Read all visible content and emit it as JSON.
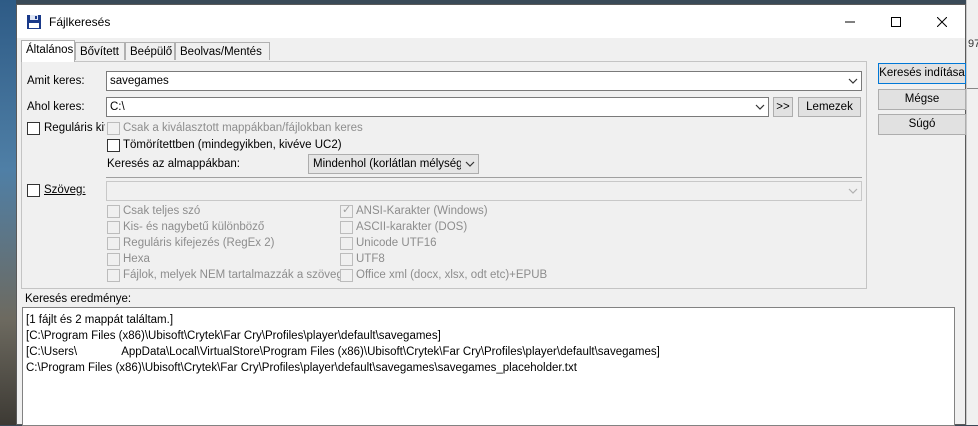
{
  "window": {
    "title": "Fájlkeresés"
  },
  "tabs": [
    "Általános",
    "Bővített",
    "Beépülő",
    "Beolvas/Mentés"
  ],
  "search_what": {
    "label": "Amit keres:",
    "value": "savegames"
  },
  "search_where": {
    "label": "Ahol keres:",
    "value": "C:\\",
    "arrows_label": ">>",
    "drives_label": "Lemezek"
  },
  "buttons": {
    "start": "Keresés indítása",
    "cancel": "Mégse",
    "help": "Súgó"
  },
  "options": {
    "regex_label": "Reguláris kife",
    "regex_checked": false,
    "selected_dirs_label": "Csak a kiválasztott mappákban/fájlokban keres",
    "compressed_label": "Tömörítettben (mindegyikben, kivéve UC2)",
    "subdirs_label": "Keresés az almappákban:",
    "subdirs_value": "Mindenhol (korlátlan mélységbe"
  },
  "text_search": {
    "label": "Szöveg:",
    "checked": false,
    "left_options": [
      {
        "label": "Csak teljes szó",
        "checked": false
      },
      {
        "label": "Kis- és nagybetű különböző",
        "checked": false
      },
      {
        "label": "Reguláris kifejezés (RegEx 2)",
        "checked": false
      },
      {
        "label": "Hexa",
        "checked": false
      },
      {
        "label": "Fájlok, melyek NEM tartalmazzák a szöveget",
        "checked": false
      }
    ],
    "right_options": [
      {
        "label": "ANSI-Karakter (Windows)",
        "checked": true
      },
      {
        "label": "ASCII-karakter (DOS)",
        "checked": false
      },
      {
        "label": "Unicode UTF16",
        "checked": false
      },
      {
        "label": "UTF8",
        "checked": false
      },
      {
        "label": "Office xml (docx, xlsx, odt etc)+EPUB",
        "checked": false
      }
    ]
  },
  "results": {
    "label": "Keresés eredménye:",
    "lines": [
      "[1 fájlt és 2 mappát találtam.]",
      "[C:\\Program Files (x86)\\Ubisoft\\Crytek\\Far Cry\\Profiles\\player\\default\\savegames]",
      "[C:\\Users\\              AppData\\Local\\VirtualStore\\Program Files (x86)\\Ubisoft\\Crytek\\Far Cry\\Profiles\\player\\default\\savegames]",
      "C:\\Program Files (x86)\\Ubisoft\\Crytek\\Far Cry\\Profiles\\player\\default\\savegames\\savegames_placeholder.txt"
    ]
  },
  "background": {
    "right_edge_text": "97"
  }
}
